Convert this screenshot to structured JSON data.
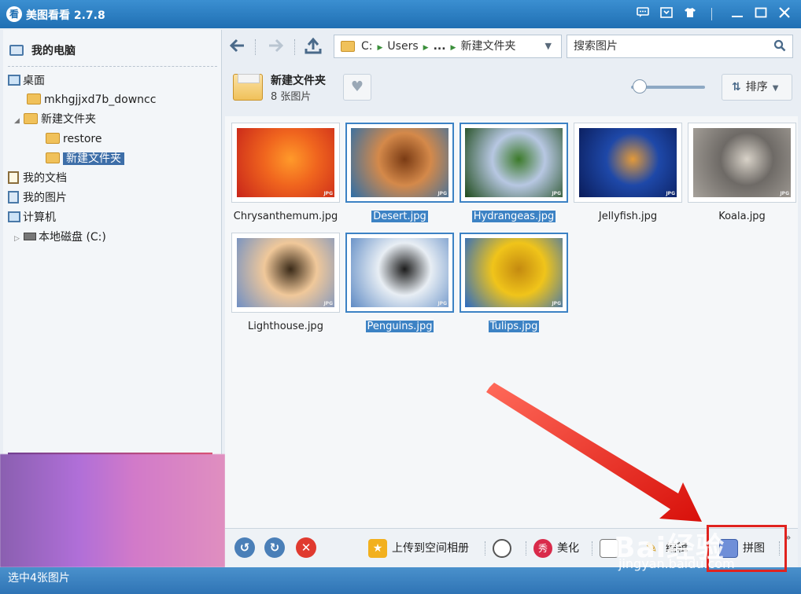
{
  "window": {
    "title": "美图看看 2.7.8",
    "logo_char": "看",
    "controls": [
      "feedback-icon",
      "menu-icon",
      "skin-icon",
      "minimize-icon",
      "maximize-icon",
      "close-icon"
    ]
  },
  "sidebar": {
    "header": "我的电脑",
    "items": [
      {
        "label": "桌面",
        "icon": "desktop-icon"
      },
      {
        "label": "mkhgjjxd7b_downcc",
        "icon": "folder-icon"
      },
      {
        "label": "新建文件夹",
        "icon": "folder-icon",
        "expanded": true
      },
      {
        "label": "restore",
        "icon": "folder-icon"
      },
      {
        "label": "新建文件夹",
        "icon": "folder-icon",
        "selected": true
      },
      {
        "label": "我的文档",
        "icon": "documents-icon"
      },
      {
        "label": "我的图片",
        "icon": "pictures-icon"
      },
      {
        "label": "计算机",
        "icon": "computer-icon"
      },
      {
        "label": "本地磁盘 (C:)",
        "icon": "drive-icon"
      }
    ]
  },
  "toolbar": {
    "address": {
      "drive": "C:",
      "segments": [
        "Users",
        "...",
        "新建文件夹"
      ]
    },
    "search": {
      "placeholder": "搜索图片"
    },
    "sort_label": "排序"
  },
  "folder": {
    "name": "新建文件夹",
    "count_label": "8 张图片",
    "zoom_level": 0.05
  },
  "images": [
    {
      "name": "Chrysanthemum.jpg",
      "selected": false,
      "colors": [
        "#c8251a",
        "#f0651e",
        "#ff9a2a"
      ]
    },
    {
      "name": "Desert.jpg",
      "selected": true,
      "colors": [
        "#2d6ea8",
        "#d4894a",
        "#7a3b14"
      ]
    },
    {
      "name": "Hydrangeas.jpg",
      "selected": true,
      "colors": [
        "#1e4a1a",
        "#b7c7e2",
        "#3c7a2a"
      ]
    },
    {
      "name": "Jellyfish.jpg",
      "selected": false,
      "colors": [
        "#0a1c5a",
        "#1e48a8",
        "#e39a3a"
      ]
    },
    {
      "name": "Koala.jpg",
      "selected": false,
      "colors": [
        "#a6a19a",
        "#6e6a66",
        "#d8d2c8"
      ]
    },
    {
      "name": "Lighthouse.jpg",
      "selected": false,
      "colors": [
        "#6f8fc4",
        "#f0c89a",
        "#3a2a18"
      ]
    },
    {
      "name": "Penguins.jpg",
      "selected": true,
      "colors": [
        "#5e8ac4",
        "#e8eef4",
        "#1c1c1c"
      ]
    },
    {
      "name": "Tulips.jpg",
      "selected": true,
      "colors": [
        "#2a6ac4",
        "#f0c41a",
        "#c48a10"
      ]
    }
  ],
  "bottombar": {
    "upload_label": "上传到空间相册",
    "beautify_label": "美化",
    "edit_label": "编辑",
    "collage_label": "拼图"
  },
  "status": {
    "text": "选中4张图片"
  },
  "watermark": {
    "text": "Bai经验",
    "url": "jingyan.baidu.com"
  },
  "colors": {
    "titlebar": "#2f7fc2",
    "selection": "#3c82c4",
    "annotation_red": "#e0231f"
  }
}
